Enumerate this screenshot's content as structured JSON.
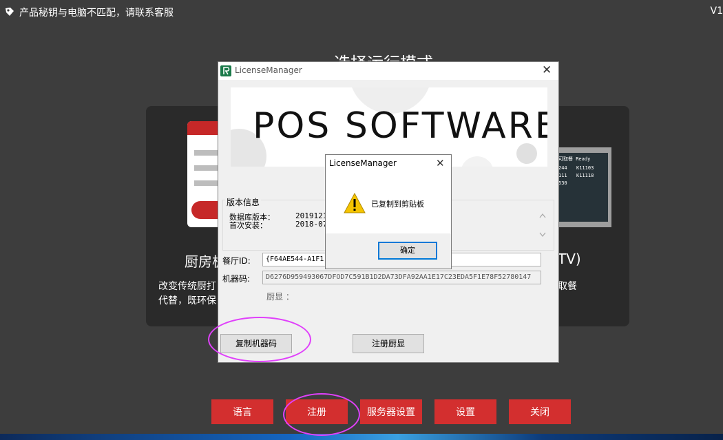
{
  "top": {
    "notice": "产品秘钥与电脑不匹配，请联系客服",
    "version": "V1"
  },
  "background": {
    "title": "选择运行模式",
    "left_card_title": "厨房板",
    "left_desc_line1": "改变传统厨打",
    "left_desc_line2": "代替，既环保",
    "right_card_title": "TV)",
    "right_desc": "取餐",
    "tv_screen": {
      "header": "可取餐 Ready",
      "rows": [
        [
          "244",
          "K11103"
        ],
        [
          "111",
          "K11118"
        ],
        [
          "530",
          ""
        ]
      ]
    }
  },
  "bottom_buttons": [
    {
      "label": "语言"
    },
    {
      "label": "注册"
    },
    {
      "label": "服务器设置"
    },
    {
      "label": "设置"
    },
    {
      "label": "关闭"
    }
  ],
  "license_dialog": {
    "title": "LicenseManager",
    "banner_text": "POS SOFTWARE",
    "version_group_label": "版本信息",
    "db_version_label": "数据库版本：",
    "db_version_value": "2019121",
    "first_install_label": "首次安装：",
    "first_install_value": "2018-07-",
    "restaurant_id_label": "餐厅ID:",
    "restaurant_id_value": "{F64AE544-A1F1-",
    "machine_code_label": "机器码:",
    "machine_code_value": "D6276D959493067DFOD7C591B1D2DA73DFA92AA1E17C23EDA5F1E78F52780147",
    "kitchen_display_label": "厨显 ：",
    "copy_button": "复制机器码",
    "register_kd_button": "注册厨显"
  },
  "message_box": {
    "title": "LicenseManager",
    "text": "已复制到剪贴板",
    "ok_button": "确定"
  },
  "colors": {
    "background": "#3d3d3d",
    "button_red": "#d32f2f",
    "highlight_circle": "#e040fb",
    "focus_blue": "#0078d7"
  }
}
